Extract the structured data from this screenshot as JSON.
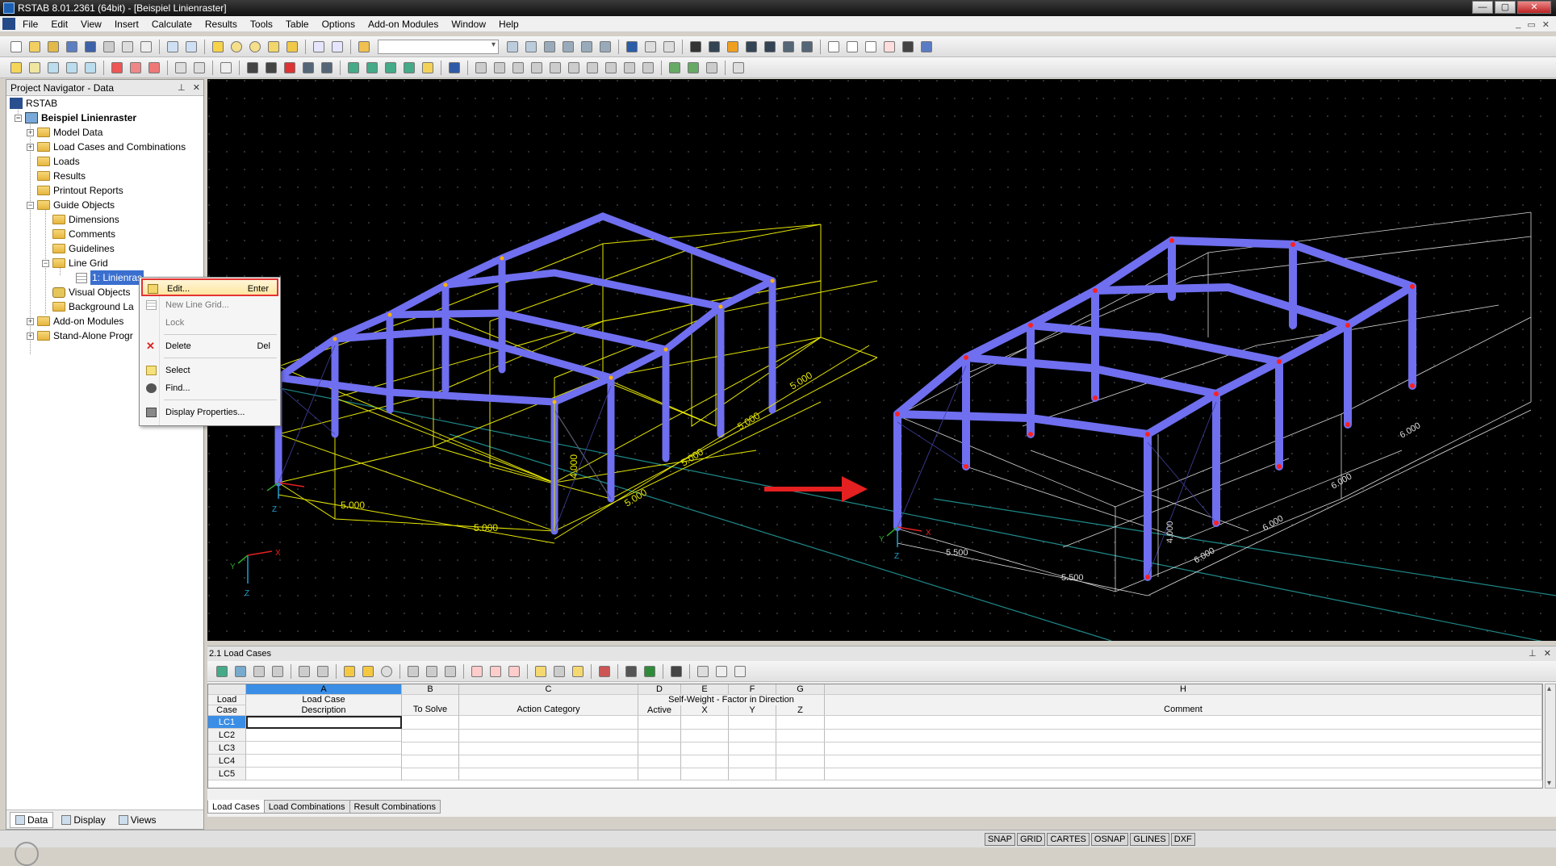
{
  "window": {
    "title": "RSTAB 8.01.2361 (64bit) - [Beispiel Linienraster]"
  },
  "menu": [
    "File",
    "Edit",
    "View",
    "Insert",
    "Calculate",
    "Results",
    "Tools",
    "Table",
    "Options",
    "Add-on Modules",
    "Window",
    "Help"
  ],
  "navigator": {
    "title": "Project Navigator - Data",
    "root": "RSTAB",
    "model": "Beispiel Linienraster",
    "items": {
      "model_data": "Model Data",
      "load_cases": "Load Cases and Combinations",
      "loads": "Loads",
      "results": "Results",
      "printout": "Printout Reports",
      "guide_objects": "Guide Objects",
      "dimensions": "Dimensions",
      "comments": "Comments",
      "guidelines": "Guidelines",
      "line_grid": "Line Grid",
      "line_grid_item": "1: Linienras",
      "visual_objects": "Visual Objects",
      "background": "Background La",
      "addon": "Add-on Modules",
      "standalone": "Stand-Alone Progr"
    },
    "tabs": [
      "Data",
      "Display",
      "Views"
    ]
  },
  "context_menu": {
    "edit": "Edit...",
    "edit_shortcut": "Enter",
    "new_grid": "New Line Grid...",
    "lock": "Lock",
    "delete": "Delete",
    "delete_shortcut": "Del",
    "select": "Select",
    "find": "Find...",
    "display_props": "Display Properties..."
  },
  "viewport": {
    "left": {
      "dims": [
        "5.000",
        "5.000",
        "5.000",
        "5.000",
        "5.000",
        "5.000"
      ],
      "height": "4.000",
      "axes": {
        "x": "X",
        "y": "Y",
        "z": "Z"
      }
    },
    "right": {
      "dims": [
        "5.500",
        "5.500",
        "6.000",
        "6.000",
        "6.000",
        "6.000"
      ],
      "height": "4.000",
      "axes": {
        "x": "X",
        "y": "Y",
        "z": "Z"
      }
    },
    "colors": {
      "member": "#6f6ff0",
      "grid_left": "#e6e600",
      "grid_right": "#ffffff",
      "node": "#ff2020",
      "arrow": "#e52020",
      "axis_line": "#1f8a8a"
    }
  },
  "table": {
    "title": "2.1 Load Cases",
    "letters": [
      "A",
      "B",
      "C",
      "D",
      "E",
      "F",
      "G",
      "H"
    ],
    "headers": {
      "load_case_1": "Load",
      "load_case_2": "Case",
      "a1": "Load Case",
      "a2": "Description",
      "b": "To Solve",
      "c": "Action Category",
      "self_weight": "Self-Weight  -  Factor in Direction",
      "d": "Active",
      "e": "X",
      "f": "Y",
      "g": "Z",
      "h": "Comment"
    },
    "rows": [
      "LC1",
      "LC2",
      "LC3",
      "LC4",
      "LC5"
    ],
    "tabs": [
      "Load Cases",
      "Load Combinations",
      "Result Combinations"
    ]
  },
  "status": [
    "SNAP",
    "GRID",
    "CARTES",
    "OSNAP",
    "GLINES",
    "DXF"
  ]
}
